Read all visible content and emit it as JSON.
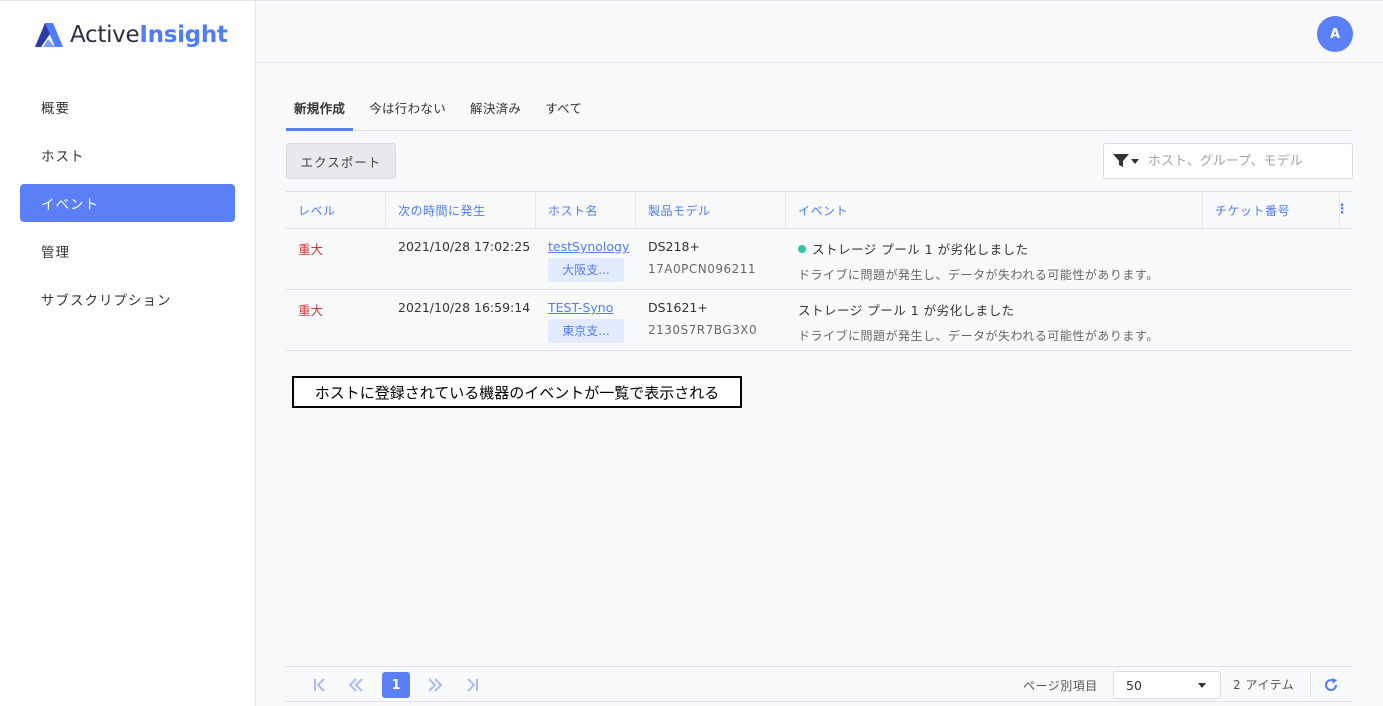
{
  "app": {
    "logo_part1": "Active",
    "logo_part2": "Insight",
    "avatar_initial": "A"
  },
  "sidebar": {
    "items": [
      {
        "label": "概要"
      },
      {
        "label": "ホスト"
      },
      {
        "label": "イベント",
        "active": true
      },
      {
        "label": "管理"
      },
      {
        "label": "サブスクリプション"
      }
    ]
  },
  "tabs": [
    {
      "label": "新規作成",
      "active": true
    },
    {
      "label": "今は行わない"
    },
    {
      "label": "解決済み"
    },
    {
      "label": "すべて"
    }
  ],
  "toolbar": {
    "export_label": "エクスポート",
    "filter_placeholder": "ホスト、グループ、モデル"
  },
  "table": {
    "headers": [
      "レベル",
      "次の時間に発生",
      "ホスト名",
      "製品モデル",
      "イベント",
      "チケット番号"
    ],
    "rows": [
      {
        "level": "重大",
        "time": "2021/10/28 17:02:25",
        "host": "testSynology",
        "group": "大阪支...",
        "model": "DS218+",
        "serial": "17A0PCN096211",
        "event_title": "ストレージ プール 1 が劣化しました",
        "event_desc": "ドライブに問題が発生し、データが失われる可能性があります。",
        "has_dot": true
      },
      {
        "level": "重大",
        "time": "2021/10/28 16:59:14",
        "host": "TEST-Syno",
        "group": "東京支...",
        "model": "DS1621+",
        "serial": "2130S7R7BG3X0",
        "event_title": "ストレージ プール 1 が劣化しました",
        "event_desc": "ドライブに問題が発生し、データが失われる可能性があります。",
        "has_dot": false
      }
    ]
  },
  "annotation": "ホストに登録されている機器のイベントが一覧で表示される",
  "pager": {
    "current_page": "1",
    "per_page_label": "ページ別項目",
    "per_page_value": "50",
    "item_count": "2 アイテム"
  },
  "colors": {
    "accent": "#5b7ff6",
    "critical": "#d9333a",
    "dot": "#2ec4a4"
  }
}
